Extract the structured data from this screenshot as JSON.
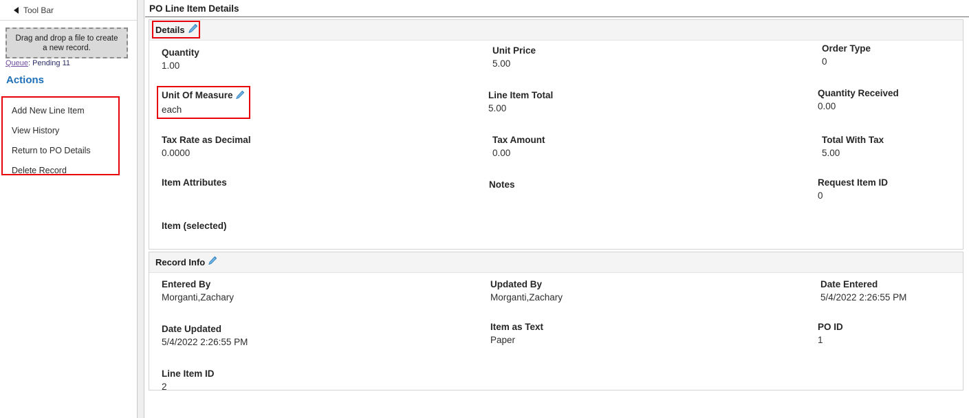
{
  "toolbar": {
    "header_label": "Tool Bar",
    "collapse_icon": "triangle-left-icon",
    "dropzone_text": "Drag and drop a file to create a new record.",
    "queue_link_label": "Queue",
    "queue_status_text": ": Pending 11",
    "actions_title": "Actions",
    "actions": [
      {
        "label": "Add New Line Item"
      },
      {
        "label": "View History"
      },
      {
        "label": "Return to PO Details"
      },
      {
        "label": "Delete Record"
      }
    ]
  },
  "main": {
    "page_title": "PO Line Item Details",
    "sections": [
      {
        "title": "Details",
        "edit_icon": "pencil-icon",
        "highlighted": true,
        "fields": [
          {
            "label": "Quantity",
            "value": "1.00",
            "col": 0,
            "row": 0
          },
          {
            "label": "Unit Price",
            "value": "5.00",
            "col": 1,
            "row": 0
          },
          {
            "label": "Order Type",
            "value": "0",
            "col": 2,
            "row": 0
          },
          {
            "label": "Unit Of Measure",
            "value": "each",
            "col": 0,
            "row": 1,
            "edit_icon": "pencil-icon",
            "highlighted": true
          },
          {
            "label": "Line Item Total",
            "value": "5.00",
            "col": 1,
            "row": 1
          },
          {
            "label": "Quantity Received",
            "value": "0.00",
            "col": 2,
            "row": 1
          },
          {
            "label": "Tax Rate as Decimal",
            "value": "0.0000",
            "col": 0,
            "row": 2
          },
          {
            "label": "Tax Amount",
            "value": "0.00",
            "col": 1,
            "row": 2
          },
          {
            "label": "Total With Tax",
            "value": "5.00",
            "col": 2,
            "row": 2
          },
          {
            "label": "Item Attributes",
            "value": "",
            "col": 0,
            "row": 3
          },
          {
            "label": "Notes",
            "value": "",
            "col": 1,
            "row": 3
          },
          {
            "label": "Request Item ID",
            "value": "0",
            "col": 2,
            "row": 3
          },
          {
            "label": "Item (selected)",
            "value": "",
            "col": 0,
            "row": 4
          }
        ]
      },
      {
        "title": "Record Info",
        "edit_icon": "pencil-icon",
        "highlighted": false,
        "fields": [
          {
            "label": "Entered By",
            "value": "Morganti,Zachary",
            "col": 0,
            "row": 0
          },
          {
            "label": "Updated By",
            "value": "Morganti,Zachary",
            "col": 1,
            "row": 0
          },
          {
            "label": "Date Entered",
            "value": "5/4/2022 2:26:55 PM",
            "col": 2,
            "row": 0
          },
          {
            "label": "Date Updated",
            "value": "5/4/2022 2:26:55 PM",
            "col": 0,
            "row": 1
          },
          {
            "label": "Item as Text",
            "value": "Paper",
            "col": 1,
            "row": 1
          },
          {
            "label": "PO ID",
            "value": "1",
            "col": 2,
            "row": 1
          },
          {
            "label": "Line Item ID",
            "value": "2",
            "col": 0,
            "row": 2
          }
        ]
      }
    ]
  },
  "colors": {
    "annotation_red": "#e8000a",
    "link_blue": "#1d6fb8",
    "visited_link_purple": "#6e4b9e",
    "pencil_blue": "#3b8fd4"
  }
}
